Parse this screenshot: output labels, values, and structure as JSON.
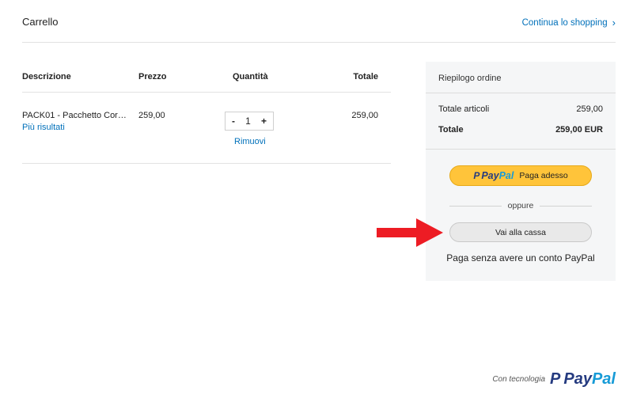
{
  "header": {
    "title": "Carrello",
    "continue_label": "Continua lo shopping",
    "continue_icon": "chevron-right-icon"
  },
  "table": {
    "headers": {
      "description": "Descrizione",
      "price": "Prezzo",
      "quantity": "Quantità",
      "total": "Totale"
    },
    "items": [
      {
        "name": "PACK01 - Pacchetto Corso...",
        "more": "Più risultati",
        "price": "259,00",
        "quantity": "1",
        "decrement": "-",
        "increment": "+",
        "remove": "Rimuovi",
        "total": "259,00"
      }
    ]
  },
  "summary": {
    "title": "Riepilogo ordine",
    "items_label": "Totale articoli",
    "items_value": "259,00",
    "total_label": "Totale",
    "total_value": "259,00 EUR",
    "paypal_button": {
      "mark": "P",
      "brand_pay": "Pay",
      "brand_pal": "Pal",
      "label": "Paga adesso"
    },
    "or_text": "oppure",
    "checkout_label": "Vai alla cassa",
    "guest_text": "Paga senza avere un conto PayPal"
  },
  "footer": {
    "powered_text": "Con tecnologia",
    "logo_mark": "P",
    "logo_pay": "Pay",
    "logo_pal": "Pal"
  },
  "colors": {
    "link": "#0070ba",
    "paypal_yellow": "#ffc43a",
    "paypal_dark_blue": "#253b80",
    "paypal_light_blue": "#179bd7",
    "arrow_red": "#ed1c24"
  }
}
